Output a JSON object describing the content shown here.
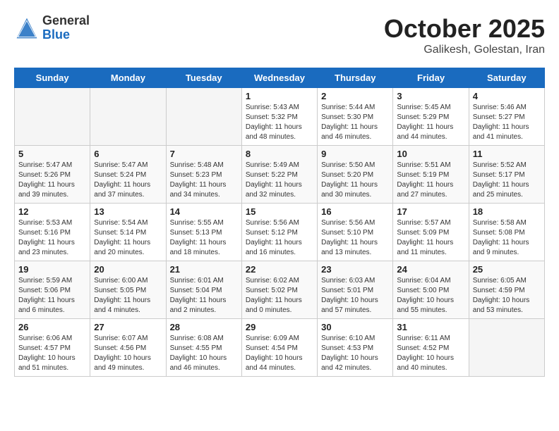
{
  "header": {
    "logo_general": "General",
    "logo_blue": "Blue",
    "title": "October 2025",
    "location": "Galikesh, Golestan, Iran"
  },
  "weekdays": [
    "Sunday",
    "Monday",
    "Tuesday",
    "Wednesday",
    "Thursday",
    "Friday",
    "Saturday"
  ],
  "weeks": [
    [
      {
        "num": "",
        "detail": ""
      },
      {
        "num": "",
        "detail": ""
      },
      {
        "num": "",
        "detail": ""
      },
      {
        "num": "1",
        "detail": "Sunrise: 5:43 AM\nSunset: 5:32 PM\nDaylight: 11 hours\nand 48 minutes."
      },
      {
        "num": "2",
        "detail": "Sunrise: 5:44 AM\nSunset: 5:30 PM\nDaylight: 11 hours\nand 46 minutes."
      },
      {
        "num": "3",
        "detail": "Sunrise: 5:45 AM\nSunset: 5:29 PM\nDaylight: 11 hours\nand 44 minutes."
      },
      {
        "num": "4",
        "detail": "Sunrise: 5:46 AM\nSunset: 5:27 PM\nDaylight: 11 hours\nand 41 minutes."
      }
    ],
    [
      {
        "num": "5",
        "detail": "Sunrise: 5:47 AM\nSunset: 5:26 PM\nDaylight: 11 hours\nand 39 minutes."
      },
      {
        "num": "6",
        "detail": "Sunrise: 5:47 AM\nSunset: 5:24 PM\nDaylight: 11 hours\nand 37 minutes."
      },
      {
        "num": "7",
        "detail": "Sunrise: 5:48 AM\nSunset: 5:23 PM\nDaylight: 11 hours\nand 34 minutes."
      },
      {
        "num": "8",
        "detail": "Sunrise: 5:49 AM\nSunset: 5:22 PM\nDaylight: 11 hours\nand 32 minutes."
      },
      {
        "num": "9",
        "detail": "Sunrise: 5:50 AM\nSunset: 5:20 PM\nDaylight: 11 hours\nand 30 minutes."
      },
      {
        "num": "10",
        "detail": "Sunrise: 5:51 AM\nSunset: 5:19 PM\nDaylight: 11 hours\nand 27 minutes."
      },
      {
        "num": "11",
        "detail": "Sunrise: 5:52 AM\nSunset: 5:17 PM\nDaylight: 11 hours\nand 25 minutes."
      }
    ],
    [
      {
        "num": "12",
        "detail": "Sunrise: 5:53 AM\nSunset: 5:16 PM\nDaylight: 11 hours\nand 23 minutes."
      },
      {
        "num": "13",
        "detail": "Sunrise: 5:54 AM\nSunset: 5:14 PM\nDaylight: 11 hours\nand 20 minutes."
      },
      {
        "num": "14",
        "detail": "Sunrise: 5:55 AM\nSunset: 5:13 PM\nDaylight: 11 hours\nand 18 minutes."
      },
      {
        "num": "15",
        "detail": "Sunrise: 5:56 AM\nSunset: 5:12 PM\nDaylight: 11 hours\nand 16 minutes."
      },
      {
        "num": "16",
        "detail": "Sunrise: 5:56 AM\nSunset: 5:10 PM\nDaylight: 11 hours\nand 13 minutes."
      },
      {
        "num": "17",
        "detail": "Sunrise: 5:57 AM\nSunset: 5:09 PM\nDaylight: 11 hours\nand 11 minutes."
      },
      {
        "num": "18",
        "detail": "Sunrise: 5:58 AM\nSunset: 5:08 PM\nDaylight: 11 hours\nand 9 minutes."
      }
    ],
    [
      {
        "num": "19",
        "detail": "Sunrise: 5:59 AM\nSunset: 5:06 PM\nDaylight: 11 hours\nand 6 minutes."
      },
      {
        "num": "20",
        "detail": "Sunrise: 6:00 AM\nSunset: 5:05 PM\nDaylight: 11 hours\nand 4 minutes."
      },
      {
        "num": "21",
        "detail": "Sunrise: 6:01 AM\nSunset: 5:04 PM\nDaylight: 11 hours\nand 2 minutes."
      },
      {
        "num": "22",
        "detail": "Sunrise: 6:02 AM\nSunset: 5:02 PM\nDaylight: 11 hours\nand 0 minutes."
      },
      {
        "num": "23",
        "detail": "Sunrise: 6:03 AM\nSunset: 5:01 PM\nDaylight: 10 hours\nand 57 minutes."
      },
      {
        "num": "24",
        "detail": "Sunrise: 6:04 AM\nSunset: 5:00 PM\nDaylight: 10 hours\nand 55 minutes."
      },
      {
        "num": "25",
        "detail": "Sunrise: 6:05 AM\nSunset: 4:59 PM\nDaylight: 10 hours\nand 53 minutes."
      }
    ],
    [
      {
        "num": "26",
        "detail": "Sunrise: 6:06 AM\nSunset: 4:57 PM\nDaylight: 10 hours\nand 51 minutes."
      },
      {
        "num": "27",
        "detail": "Sunrise: 6:07 AM\nSunset: 4:56 PM\nDaylight: 10 hours\nand 49 minutes."
      },
      {
        "num": "28",
        "detail": "Sunrise: 6:08 AM\nSunset: 4:55 PM\nDaylight: 10 hours\nand 46 minutes."
      },
      {
        "num": "29",
        "detail": "Sunrise: 6:09 AM\nSunset: 4:54 PM\nDaylight: 10 hours\nand 44 minutes."
      },
      {
        "num": "30",
        "detail": "Sunrise: 6:10 AM\nSunset: 4:53 PM\nDaylight: 10 hours\nand 42 minutes."
      },
      {
        "num": "31",
        "detail": "Sunrise: 6:11 AM\nSunset: 4:52 PM\nDaylight: 10 hours\nand 40 minutes."
      },
      {
        "num": "",
        "detail": ""
      }
    ]
  ]
}
